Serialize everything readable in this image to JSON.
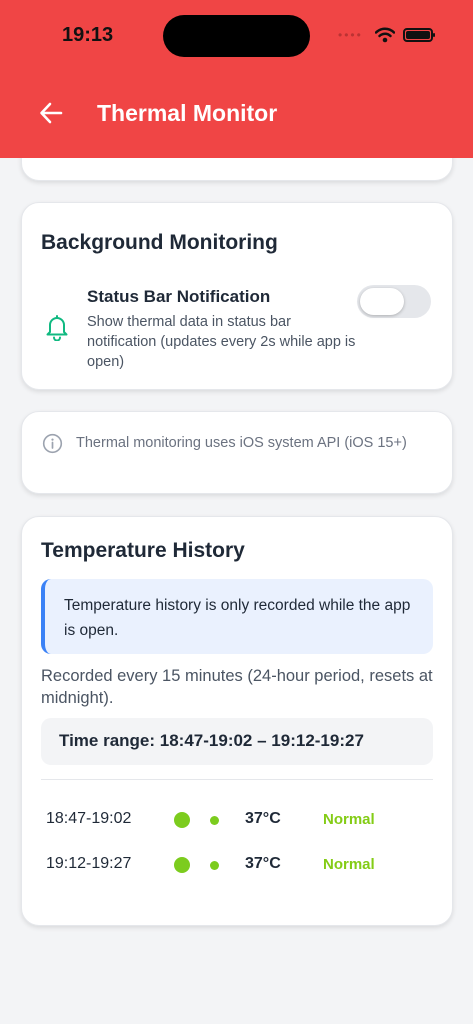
{
  "status_bar": {
    "time": "19:13",
    "signal_icon": "signal-dots-icon",
    "wifi_icon": "wifi-icon",
    "battery_icon": "battery-icon"
  },
  "header": {
    "title": "Thermal Monitor",
    "back_icon": "arrow-left-icon",
    "color": "#f04545"
  },
  "background_monitoring": {
    "title": "Background Monitoring",
    "notification": {
      "icon": "bell-icon",
      "title": "Status Bar Notification",
      "description": "Show thermal data in status bar notification (updates every 2s while app is open)",
      "enabled": false
    }
  },
  "info": {
    "icon": "info-icon",
    "text": "Thermal monitoring uses iOS system API (iOS 15+)"
  },
  "history": {
    "title": "Temperature History",
    "notice": "Temperature history is only recorded while the app is open.",
    "recorded_note": "Recorded every 15 minutes (24-hour period, resets at midnight).",
    "time_range": "Time range: 18:47-19:02 – 19:12-19:27",
    "rows": [
      {
        "time": "18:47-19:02",
        "temp": "37°C",
        "status": "Normal"
      },
      {
        "time": "19:12-19:27",
        "temp": "37°C",
        "status": "Normal"
      }
    ],
    "status_color": "#84cc16"
  }
}
